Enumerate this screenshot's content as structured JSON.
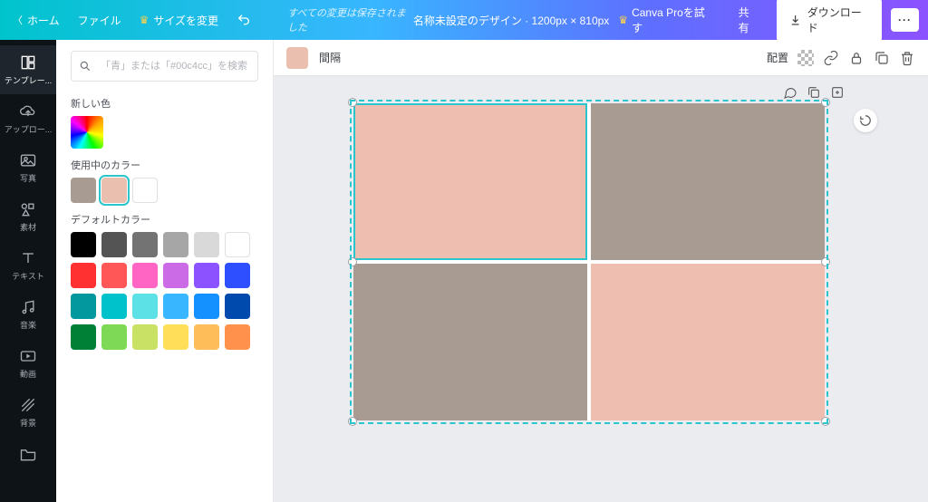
{
  "topbar": {
    "home": "ホーム",
    "file": "ファイル",
    "resize": "サイズを変更",
    "saved_msg": "すべての変更は保存されました",
    "doc_title": "名称未設定のデザイン · 1200px × 810px",
    "try_pro": "Canva Proを試す",
    "share": "共有",
    "download": "ダウンロード"
  },
  "rail": {
    "items": [
      {
        "id": "templates",
        "label": "テンプレー..."
      },
      {
        "id": "uploads",
        "label": "アップロー..."
      },
      {
        "id": "photos",
        "label": "写真"
      },
      {
        "id": "elements",
        "label": "素材"
      },
      {
        "id": "text",
        "label": "テキスト"
      },
      {
        "id": "music",
        "label": "音楽"
      },
      {
        "id": "video",
        "label": "動画"
      },
      {
        "id": "bg",
        "label": "背景"
      }
    ]
  },
  "panel": {
    "search_placeholder": "「青」または「#00c4cc」を検索",
    "new_color_label": "新しい色",
    "in_use_label": "使用中のカラー",
    "default_label": "デフォルトカラー",
    "in_use_colors": [
      {
        "hex": "#a79b92",
        "selected": false
      },
      {
        "hex": "#ebbfb0",
        "selected": true
      },
      {
        "hex": "#ffffff",
        "selected": false,
        "outline": true
      }
    ],
    "default_colors": [
      "#000000",
      "#545454",
      "#737373",
      "#a6a6a6",
      "#d9d9d9",
      "#ffffff",
      "#ff3131",
      "#ff5757",
      "#ff66c4",
      "#cb6ce6",
      "#8c52ff",
      "#2e4fff",
      "#03989e",
      "#00c2cb",
      "#5ce1e6",
      "#38b6ff",
      "#1591ff",
      "#004aad",
      "#008037",
      "#7ed957",
      "#c9e265",
      "#ffde59",
      "#ffbd59",
      "#ff914d"
    ]
  },
  "context": {
    "fill_color": "#ebbfb0",
    "spacing": "間隔",
    "position": "配置"
  },
  "canvas": {
    "cells": [
      {
        "color": "#eebfb1",
        "selected": true
      },
      {
        "color": "#a79b92",
        "selected": false
      },
      {
        "color": "#a79b92",
        "selected": false
      },
      {
        "color": "#eebfb1",
        "selected": false
      }
    ]
  }
}
